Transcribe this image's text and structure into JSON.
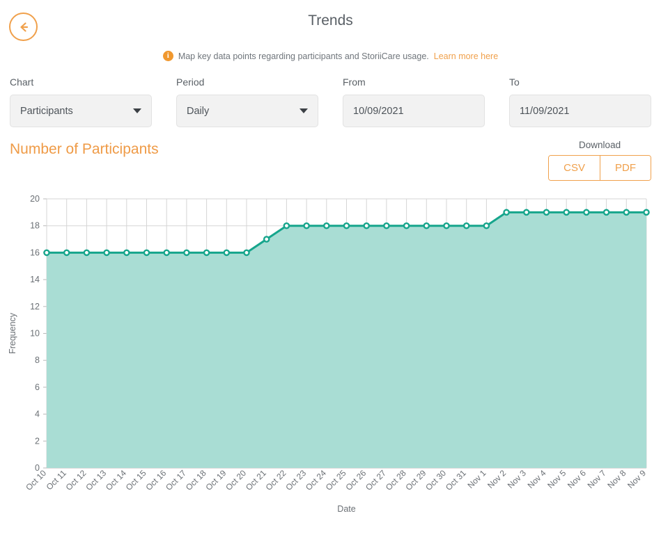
{
  "header": {
    "title": "Trends",
    "back_icon": "arrow-left-icon"
  },
  "info": {
    "icon": "info-icon",
    "glyph": "i",
    "text": "Map key data points regarding participants and StoriiCare usage.",
    "link_text": "Learn more here"
  },
  "filters": [
    {
      "label": "Chart",
      "value": "Participants",
      "type": "select",
      "name": "chart"
    },
    {
      "label": "Period",
      "value": "Daily",
      "type": "select",
      "name": "period"
    },
    {
      "label": "From",
      "value": "10/09/2021",
      "type": "date",
      "name": "from"
    },
    {
      "label": "To",
      "value": "11/09/2021",
      "type": "date",
      "name": "to"
    }
  ],
  "chart_header": {
    "title": "Number of Participants",
    "download_label": "Download",
    "buttons": [
      {
        "label": "CSV"
      },
      {
        "label": "PDF"
      }
    ]
  },
  "colors": {
    "accent_orange": "#f0a04b",
    "title_orange": "#ef9b47",
    "line_teal": "#16a58c",
    "area_teal": "#a9ddd4",
    "grid": "#d5d5d5",
    "text_gray": "#6b7075"
  },
  "chart_data": {
    "type": "area",
    "title": "Number of Participants",
    "xlabel": "Date",
    "ylabel": "Frequency",
    "ylim": [
      0,
      20
    ],
    "yticks": [
      0,
      2,
      4,
      6,
      8,
      10,
      12,
      14,
      16,
      18,
      20
    ],
    "grid": true,
    "legend": "none",
    "categories": [
      "Oct 10",
      "Oct 11",
      "Oct 12",
      "Oct 13",
      "Oct 14",
      "Oct 15",
      "Oct 16",
      "Oct 17",
      "Oct 18",
      "Oct 19",
      "Oct 20",
      "Oct 21",
      "Oct 22",
      "Oct 23",
      "Oct 24",
      "Oct 25",
      "Oct 26",
      "Oct 27",
      "Oct 28",
      "Oct 29",
      "Oct 30",
      "Oct 31",
      "Nov 1",
      "Nov 2",
      "Nov 3",
      "Nov 4",
      "Nov 5",
      "Nov 6",
      "Nov 7",
      "Nov 8",
      "Nov 9"
    ],
    "values": [
      16,
      16,
      16,
      16,
      16,
      16,
      16,
      16,
      16,
      16,
      16,
      17,
      18,
      18,
      18,
      18,
      18,
      18,
      18,
      18,
      18,
      18,
      18,
      19,
      19,
      19,
      19,
      19,
      19,
      19,
      19
    ]
  }
}
